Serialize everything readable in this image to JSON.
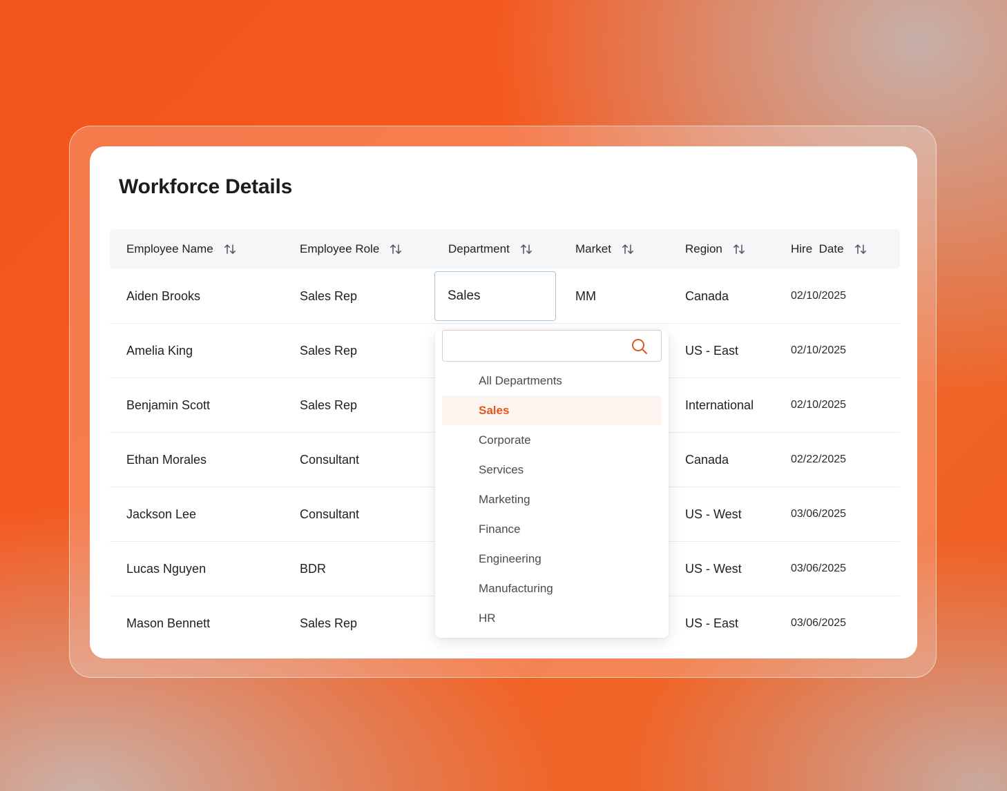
{
  "card": {
    "title": "Workforce Details"
  },
  "table": {
    "headers": [
      "Employee Name",
      "Employee Role",
      "Department",
      "Market",
      "Region",
      "Hire  Date"
    ],
    "rows": [
      {
        "name": "Aiden Brooks",
        "role": "Sales Rep",
        "department": "Sales",
        "market": "MM",
        "region": "Canada",
        "hire_date": "02/10/2025"
      },
      {
        "name": "Amelia King",
        "role": "Sales Rep",
        "department": "",
        "market": "",
        "region": "US - East",
        "hire_date": "02/10/2025"
      },
      {
        "name": "Benjamin Scott",
        "role": "Sales Rep",
        "department": "",
        "market": "",
        "region": "International",
        "hire_date": "02/10/2025"
      },
      {
        "name": "Ethan Morales",
        "role": "Consultant",
        "department": "",
        "market": "",
        "region": "Canada",
        "hire_date": "02/22/2025"
      },
      {
        "name": "Jackson Lee",
        "role": "Consultant",
        "department": "",
        "market": "",
        "region": "US - West",
        "hire_date": "03/06/2025"
      },
      {
        "name": "Lucas Nguyen",
        "role": "BDR",
        "department": "",
        "market": "",
        "region": "US - West",
        "hire_date": "03/06/2025"
      },
      {
        "name": "Mason Bennett",
        "role": "Sales Rep",
        "department": "",
        "market": "",
        "region": "US - East",
        "hire_date": "03/06/2025"
      }
    ]
  },
  "dropdown": {
    "search_value": "",
    "search_placeholder": "",
    "selected": "Sales",
    "options": [
      "All Departments",
      "Sales",
      "Corporate",
      "Services",
      "Marketing",
      "Finance",
      "Engineering",
      "Manufacturing",
      "HR"
    ]
  },
  "icons": {
    "sort": "sort-arrows-icon",
    "search": "search-icon"
  },
  "colors": {
    "accent": "#e3561f",
    "selected_bg": "#fdf4ef",
    "active_cell_border": "#a6c4de",
    "header_bg": "#f5f6f7",
    "background": "#f65a1d"
  }
}
